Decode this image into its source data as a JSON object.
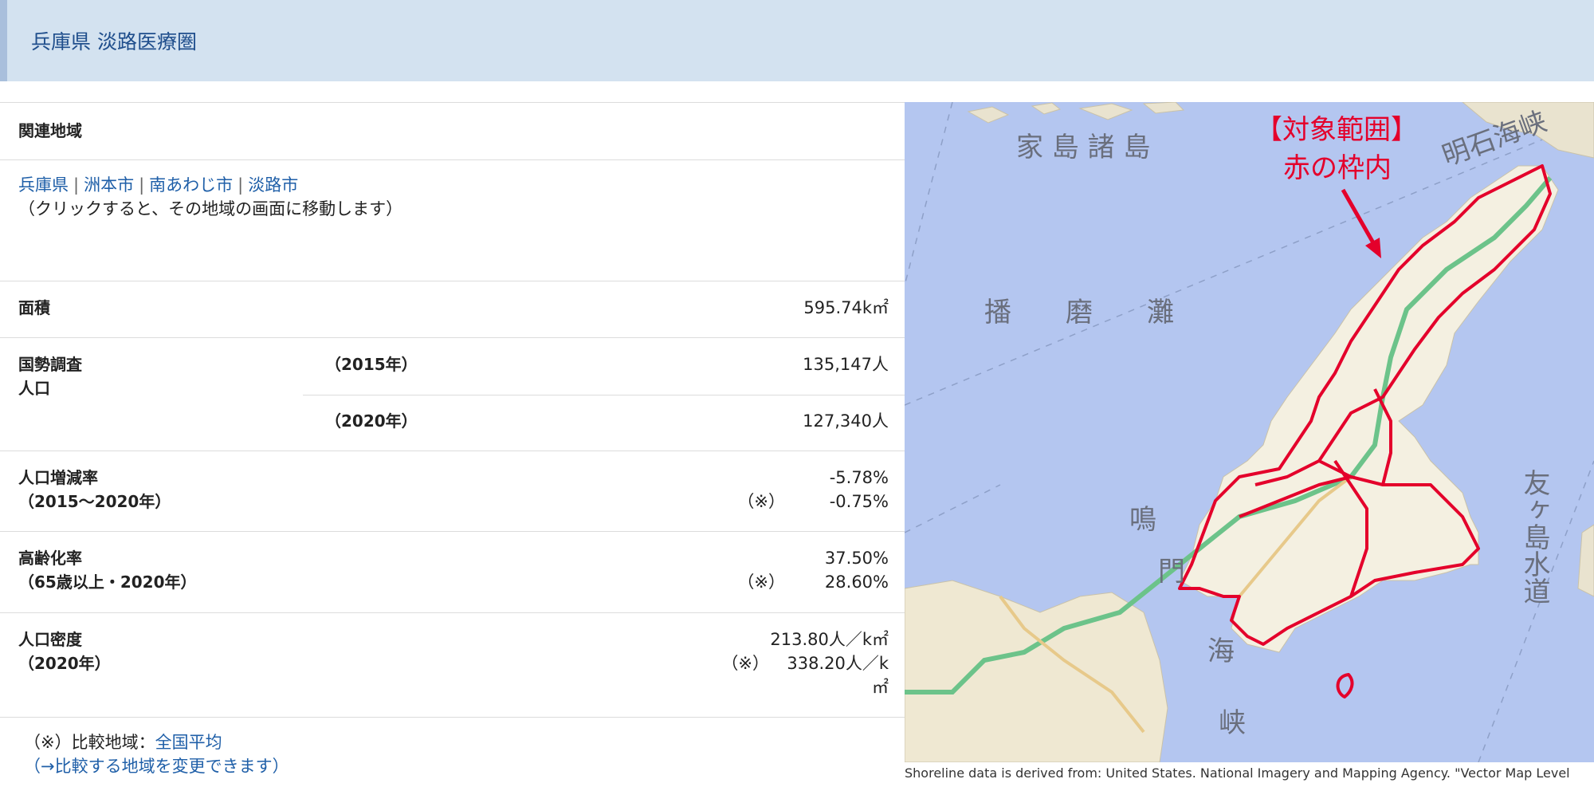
{
  "header": {
    "title": "兵庫県 淡路医療圏"
  },
  "region": {
    "label": "関連地域",
    "links": [
      "兵庫県",
      "洲本市",
      "南あわじ市",
      "淡路市"
    ],
    "hint": "（クリックすると、その地域の画面に移動します）"
  },
  "stats": {
    "area": {
      "label": "面積",
      "value": "595.74k㎡"
    },
    "census": {
      "label_line1": "国勢調査",
      "label_line2": "人口",
      "year1": "（2015年）",
      "value1": "135,147人",
      "year2": "（2020年）",
      "value2": "127,340人"
    },
    "growth": {
      "label_line1": "人口増減率",
      "label_line2": "（2015～2020年）",
      "value": "-5.78%",
      "compare_mark": "（※）",
      "compare_value": "-0.75%"
    },
    "aging": {
      "label_line1": "高齢化率",
      "label_line2": "（65歳以上・2020年）",
      "value": "37.50%",
      "compare_mark": "（※）",
      "compare_value": "28.60%"
    },
    "density": {
      "label_line1": "人口密度",
      "label_line2": "（2020年）",
      "value": "213.80人／k㎡",
      "compare_mark": "（※）",
      "compare_value_line1": "338.20人／k",
      "compare_value_line2": "㎡"
    }
  },
  "footer": {
    "compare_prefix": "（※）比較地域：",
    "compare_link": "全国平均",
    "change_link": "（→比較する地域を変更できます）"
  },
  "map": {
    "target_line1": "【対象範囲】",
    "target_line2": "赤の枠内",
    "place_names": [
      "家 島 諸 島",
      "明石海峡",
      "播　　磨　　灘",
      "鳴",
      "門",
      "海",
      "峡",
      "友ヶ島水道"
    ],
    "credit": "Shoreline data is derived from: United States. National Imagery and Mapping Agency. \"Vector Map Level"
  },
  "colors": {
    "header_bg": "#d3e2f0",
    "link": "#1f5fa8",
    "boundary": "#e4002b",
    "sea": "#b4c6f0"
  }
}
